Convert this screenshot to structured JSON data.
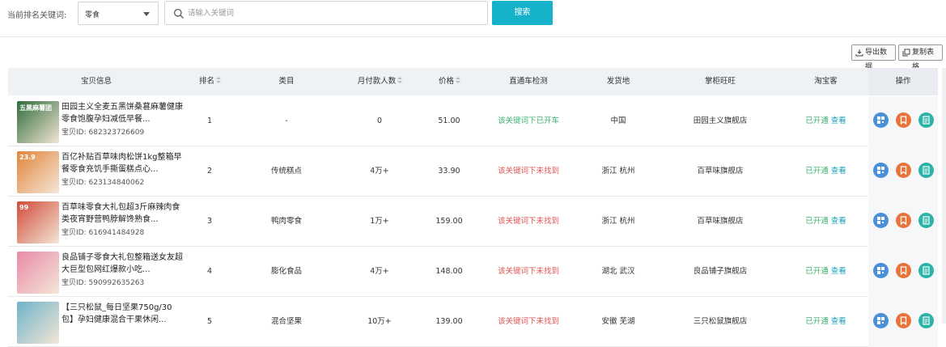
{
  "search_bar": {
    "keyword_label": "当前排名关键词:",
    "select_value": "零食",
    "input_placeholder": "请输入关键词",
    "search_button": "搜索"
  },
  "actions": {
    "export_label": "导出数据",
    "copy_label": "复制表格"
  },
  "table": {
    "headers": [
      "宝贝信息",
      "排名",
      "类目",
      "月付款人数",
      "价格",
      "直通车检测",
      "发货地",
      "掌柜旺旺",
      "淘宝客",
      "操作"
    ],
    "id_prefix": "宝贝ID:",
    "rows": [
      {
        "title": "田园主义全麦五黑饼桑葚麻薯健康零食饱腹孕妇减低早餐...",
        "item_id": "682323726609",
        "rank": "1",
        "category": "-",
        "monthly_buyers": "0",
        "price": "51.00",
        "ztc_status": "该关键词下已开车",
        "ztc_ok": true,
        "ship_from": "中国",
        "shop": "田园主义旗舰店",
        "tbk_status": "已开通",
        "tbk_link": "查看",
        "thumb_text": "五黑麻薯团",
        "thumb_color": "#2f6b3a"
      },
      {
        "title": "百亿补贴百草味肉松饼1kg整箱早餐零食充饥手撕蛋糕点心...",
        "item_id": "623134840062",
        "rank": "2",
        "category": "传统糕点",
        "monthly_buyers": "4万+",
        "price": "33.90",
        "ztc_status": "该关键词下未找到",
        "ztc_ok": false,
        "ship_from": "浙江 杭州",
        "shop": "百草味旗舰店",
        "tbk_status": "已开通",
        "tbk_link": "查看",
        "thumb_text": "23.9",
        "thumb_color": "#e2853a"
      },
      {
        "title": "百草味零食大礼包超3斤麻辣肉食类夜宵野营鸭脖解馋熟食...",
        "item_id": "616941484928",
        "rank": "3",
        "category": "鸭肉零食",
        "monthly_buyers": "1万+",
        "price": "159.00",
        "ztc_status": "该关键词下未找到",
        "ztc_ok": false,
        "ship_from": "浙江 杭州",
        "shop": "百草味旗舰店",
        "tbk_status": "已开通",
        "tbk_link": "查看",
        "thumb_text": "99",
        "thumb_color": "#d24b3a"
      },
      {
        "title": "良品铺子零食大礼包整箱送女友超大巨型包网红爆款小吃...",
        "item_id": "590992635263",
        "rank": "4",
        "category": "膨化食品",
        "monthly_buyers": "4万+",
        "price": "148.00",
        "ztc_status": "该关键词下未找到",
        "ztc_ok": false,
        "ship_from": "湖北 武汉",
        "shop": "良品铺子旗舰店",
        "tbk_status": "已开通",
        "tbk_link": "查看",
        "thumb_text": "",
        "thumb_color": "#e98aa8"
      },
      {
        "title": "【三只松鼠_每日坚果750g/30包】孕妇健康混合干果休闲...",
        "item_id": "",
        "rank": "5",
        "category": "混合坚果",
        "monthly_buyers": "10万+",
        "price": "139.00",
        "ztc_status": "该关键词下未找到",
        "ztc_ok": false,
        "ship_from": "安徽 芜湖",
        "shop": "三只松鼠旗舰店",
        "tbk_status": "已开通",
        "tbk_link": "查看",
        "thumb_text": "",
        "thumb_color": "#6fb3c9"
      }
    ],
    "op_colors": [
      "#4a90d9",
      "#e8743b",
      "#2bb3a8"
    ]
  }
}
